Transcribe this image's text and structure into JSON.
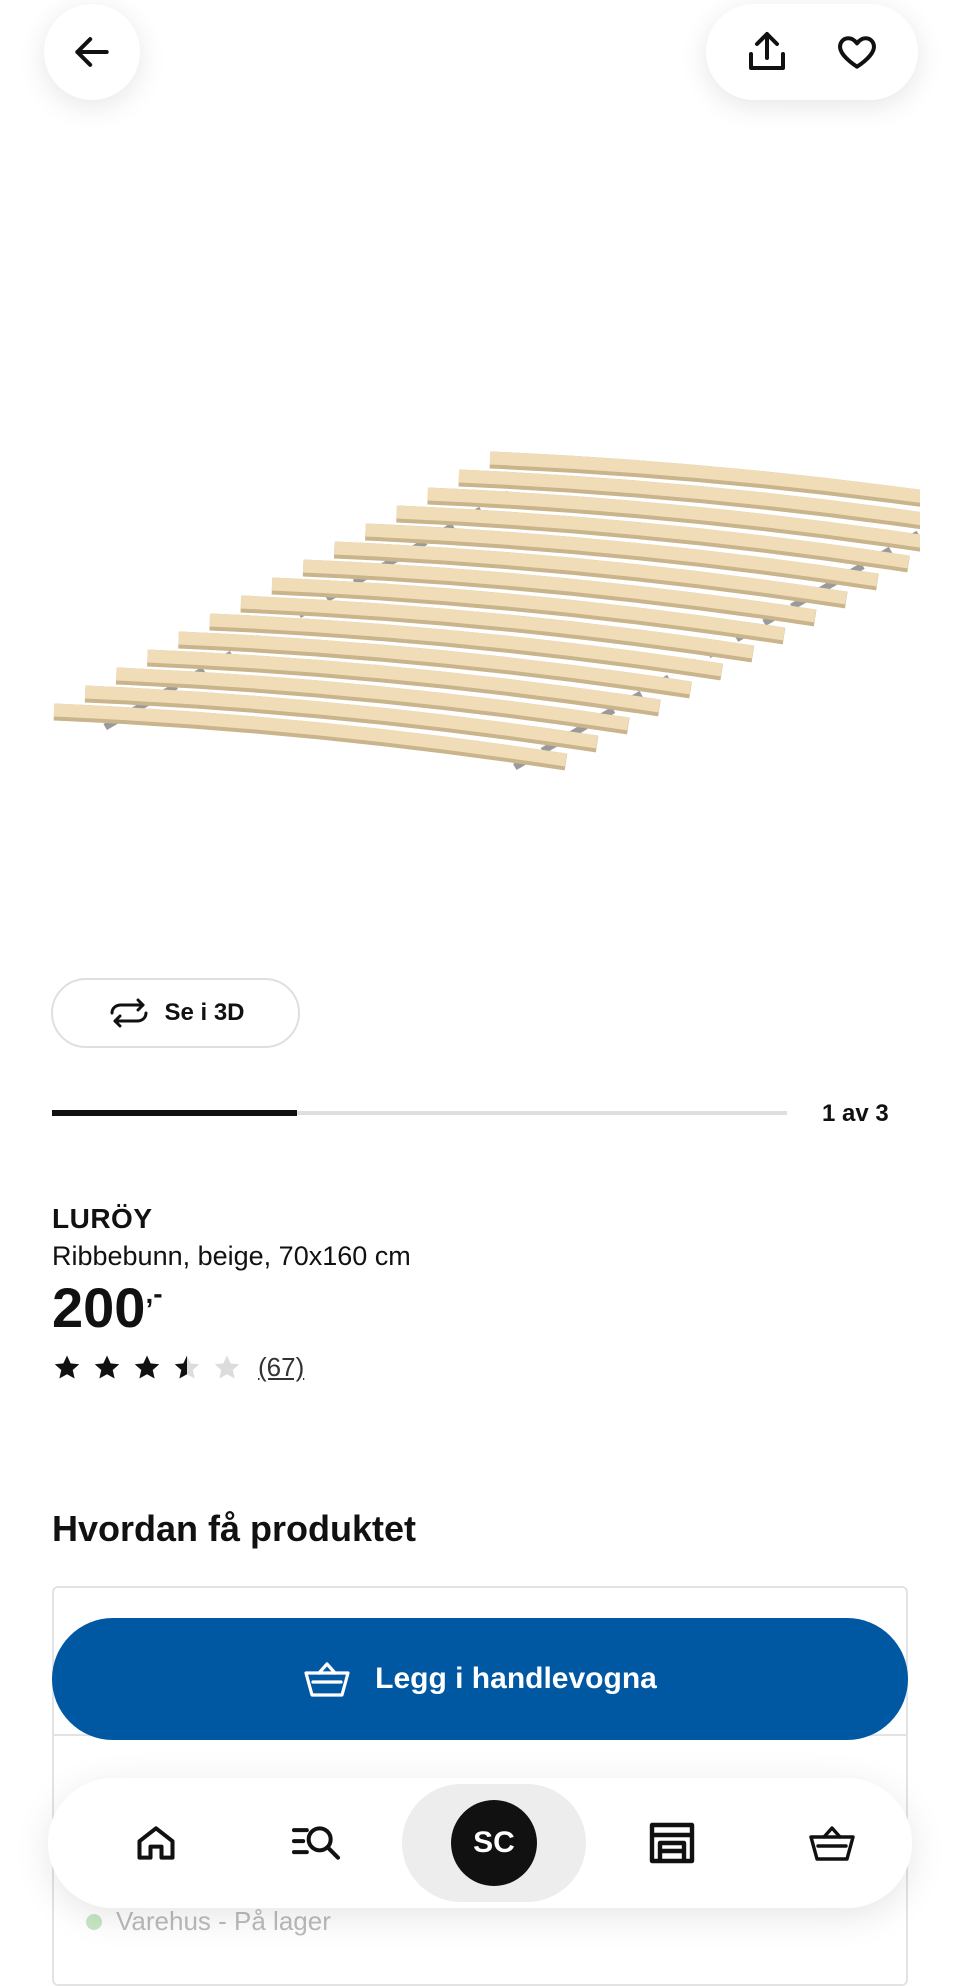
{
  "header": {
    "back_icon": "arrow-left-icon",
    "share_icon": "share-upload-icon",
    "favorite_icon": "heart-icon"
  },
  "gallery": {
    "image_alt": "product-image",
    "view_3d_label": "Se i 3D",
    "view_3d_icon": "rotate-3d-icon",
    "page_indicator": "1 av 3",
    "current_page": 1,
    "total_pages": 3
  },
  "product": {
    "brand": "LURÖY",
    "description": "Ribbebunn, beige, 70x160 cm",
    "price": "200",
    "price_suffix": ",-",
    "rating": 3.5,
    "rating_max": 5,
    "review_count": "(67)"
  },
  "how_to_get": {
    "title": "Hvordan få produktet",
    "add_to_cart_label": "Legg i handlevogna",
    "store_status": "Varehus - På lager"
  },
  "bottom_nav": {
    "items": [
      {
        "name": "home-icon"
      },
      {
        "name": "search-list-icon"
      },
      {
        "name": "avatar",
        "initials": "SC"
      },
      {
        "name": "store-icon"
      },
      {
        "name": "cart-icon"
      }
    ]
  },
  "colors": {
    "primary_blue": "#0058a3",
    "text": "#111111",
    "track": "#dfdfdf",
    "slat": "#f0ddb8",
    "strap": "#9a9a9a"
  }
}
